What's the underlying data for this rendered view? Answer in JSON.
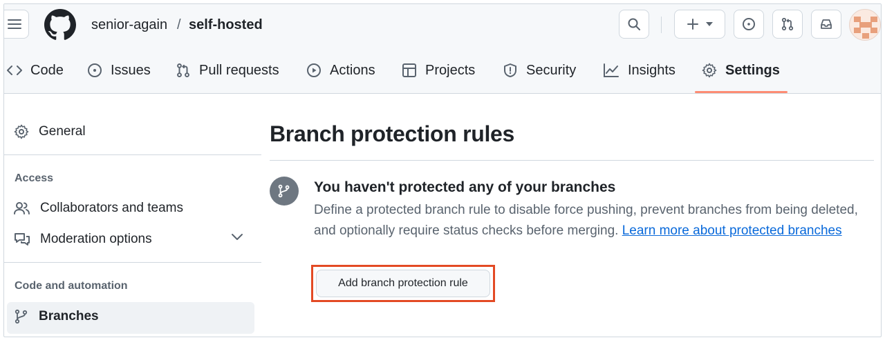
{
  "header": {
    "owner": "senior-again",
    "separator": "/",
    "repo": "self-hosted"
  },
  "tabs": [
    {
      "label": "Code",
      "icon": "code-icon"
    },
    {
      "label": "Issues",
      "icon": "issue-opened-icon"
    },
    {
      "label": "Pull requests",
      "icon": "git-pull-request-icon"
    },
    {
      "label": "Actions",
      "icon": "play-icon"
    },
    {
      "label": "Projects",
      "icon": "table-icon"
    },
    {
      "label": "Security",
      "icon": "shield-icon"
    },
    {
      "label": "Insights",
      "icon": "graph-icon"
    },
    {
      "label": "Settings",
      "icon": "gear-icon",
      "active": true
    }
  ],
  "sidebar": {
    "general": "General",
    "access_heading": "Access",
    "collaborators": "Collaborators and teams",
    "moderation": "Moderation options",
    "code_heading": "Code and automation",
    "branches": "Branches"
  },
  "main": {
    "title": "Branch protection rules",
    "blank_heading": "You haven't protected any of your branches",
    "blank_desc": "Define a protected branch rule to disable force pushing, prevent branches from being deleted, and optionally require status checks before merging.",
    "learn_more": "Learn more about protected branches",
    "add_button": "Add branch protection rule"
  },
  "colors": {
    "accent_underline": "#fd8c73",
    "highlight_box": "#e34a24",
    "link": "#0969da"
  }
}
